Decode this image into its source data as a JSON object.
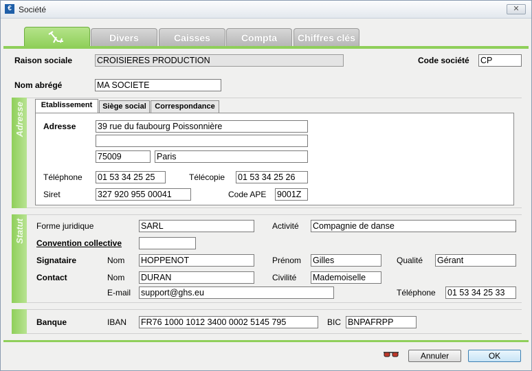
{
  "window": {
    "title": "Société",
    "app_icon": "€",
    "close_symbol": "✕"
  },
  "tabs": [
    {
      "label": "",
      "icon": "beach-chair-icon",
      "active": true
    },
    {
      "label": "Divers"
    },
    {
      "label": "Caisses"
    },
    {
      "label": "Compta"
    },
    {
      "label": "Chiffres clés"
    }
  ],
  "header": {
    "raison_sociale_label": "Raison sociale",
    "raison_sociale_value": "CROISIERES PRODUCTION",
    "code_societe_label": "Code société",
    "code_societe_value": "CP",
    "nom_abrege_label": "Nom abrégé",
    "nom_abrege_value": "MA SOCIETE"
  },
  "adresse": {
    "section_label": "Adresse",
    "subtabs": [
      "Etablissement",
      "Siège social",
      "Correspondance"
    ],
    "adresse_label": "Adresse",
    "line1": "39 rue du faubourg Poissonnière",
    "line2": "",
    "postal_code": "75009",
    "city": "Paris",
    "telephone_label": "Téléphone",
    "telephone_value": "01 53 34 25 25",
    "telecopie_label": "Télécopie",
    "telecopie_value": "01 53 34 25 26",
    "siret_label": "Siret",
    "siret_value": "327 920 955 00041",
    "code_ape_label": "Code APE",
    "code_ape_value": "9001Z"
  },
  "statut": {
    "section_label": "Statut",
    "forme_juridique_label": "Forme juridique",
    "forme_juridique_value": "SARL",
    "activite_label": "Activité",
    "activite_value": "Compagnie de danse",
    "convention_label": "Convention collective",
    "convention_value": "",
    "signataire_label": "Signataire",
    "signataire_nom_label": "Nom",
    "signataire_nom_value": "HOPPENOT",
    "prenom_label": "Prénom",
    "prenom_value": "Gilles",
    "qualite_label": "Qualité",
    "qualite_value": "Gérant",
    "contact_label": "Contact",
    "contact_nom_label": "Nom",
    "contact_nom_value": "DURAN",
    "civilite_label": "Civilité",
    "civilite_value": "Mademoiselle",
    "email_label": "E-mail",
    "email_value": "support@ghs.eu",
    "contact_tel_label": "Téléphone",
    "contact_tel_value": "01 53 34 25 33"
  },
  "banque": {
    "label": "Banque",
    "iban_label": "IBAN",
    "iban_value": "FR76 1000 1012 3400 0002 5145 795",
    "bic_label": "BIC",
    "bic_value": "BNPAFRPP"
  },
  "footer": {
    "cancel_label": "Annuler",
    "ok_label": "OK",
    "glasses_icon": "glasses-icon"
  }
}
